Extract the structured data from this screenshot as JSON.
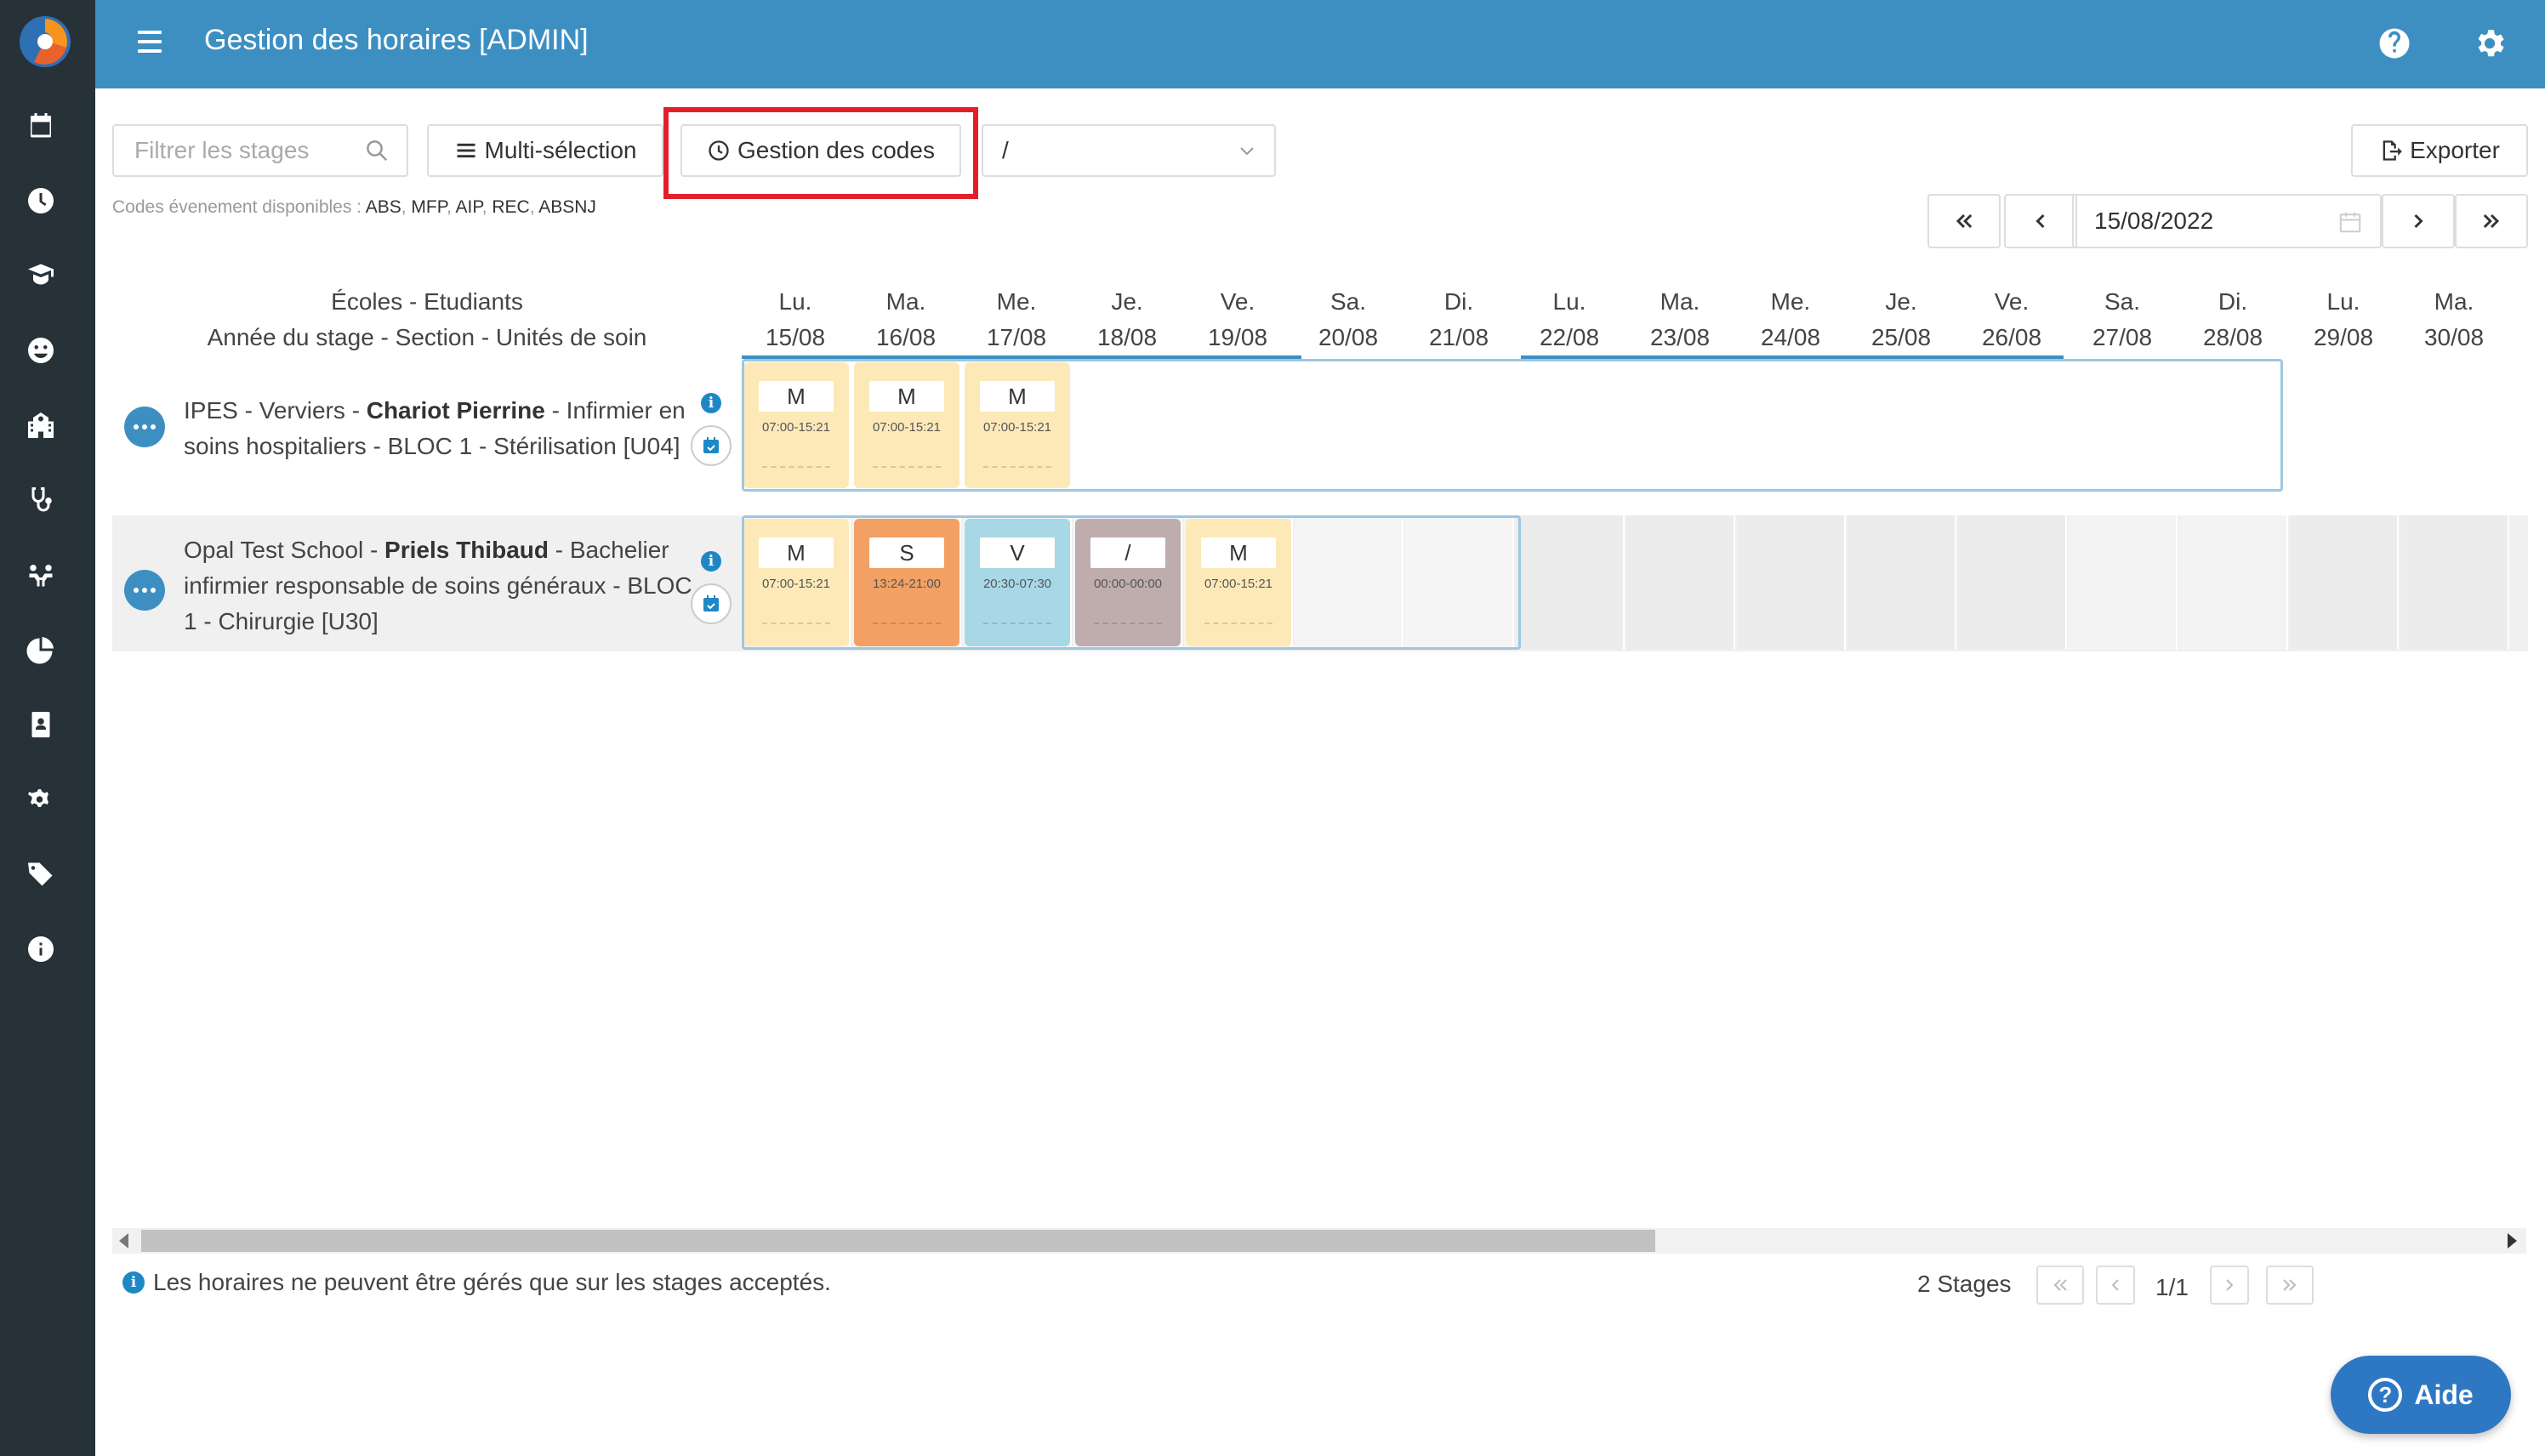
{
  "header": {
    "title": "Gestion des horaires [ADMIN]",
    "icons": [
      "menu-icon",
      "help-icon",
      "gear-icon"
    ]
  },
  "sidebar": {
    "icons": [
      "calendar-icon",
      "clock-icon",
      "graduate-icon",
      "smiley-icon",
      "school-icon",
      "stethoscope-icon",
      "people-icon",
      "pie-chart-icon",
      "badge-icon",
      "gears-icon",
      "tags-icon",
      "info-icon"
    ]
  },
  "toolbar": {
    "filter_placeholder": "Filtrer les stages",
    "multi_selection_label": "Multi-sélection",
    "codes_management_label": "Gestion des codes",
    "select_value": "/",
    "export_label": "Exporter",
    "codes_prefix": "Codes évenement disponibles :",
    "codes": [
      "ABS",
      "MFP",
      "AIP",
      "REC",
      "ABSNJ"
    ]
  },
  "date_nav": {
    "date": "15/08/2022"
  },
  "grid": {
    "header_line1": "Écoles - Etudiants",
    "header_line2": "Année du stage - Section - Unités de soin",
    "days": [
      {
        "day": "Lu.",
        "date": "15/08"
      },
      {
        "day": "Ma.",
        "date": "16/08"
      },
      {
        "day": "Me.",
        "date": "17/08"
      },
      {
        "day": "Je.",
        "date": "18/08"
      },
      {
        "day": "Ve.",
        "date": "19/08"
      },
      {
        "day": "Sa.",
        "date": "20/08"
      },
      {
        "day": "Di.",
        "date": "21/08"
      },
      {
        "day": "Lu.",
        "date": "22/08"
      },
      {
        "day": "Ma.",
        "date": "23/08"
      },
      {
        "day": "Me.",
        "date": "24/08"
      },
      {
        "day": "Je.",
        "date": "25/08"
      },
      {
        "day": "Ve.",
        "date": "26/08"
      },
      {
        "day": "Sa.",
        "date": "27/08"
      },
      {
        "day": "Di.",
        "date": "28/08"
      },
      {
        "day": "Lu.",
        "date": "29/08"
      },
      {
        "day": "Ma.",
        "date": "30/08"
      }
    ],
    "rows": [
      {
        "school": "IPES - Verviers -",
        "student": "Chariot Pierrine",
        "rest1": "- Infirmier en",
        "line2": "soins hospitaliers - BLOC 1 - Stérilisation [U04]",
        "shifts": [
          {
            "code": "M",
            "time": "07:00-15:21",
            "color": "#fde9b8"
          },
          {
            "code": "M",
            "time": "07:00-15:21",
            "color": "#fde9b8"
          },
          {
            "code": "M",
            "time": "07:00-15:21",
            "color": "#fde9b8"
          }
        ]
      },
      {
        "school": "Opal Test School -",
        "student": "Priels Thibaud",
        "rest1": "- Bachelier",
        "line2": "infirmier responsable de soins généraux - BLOC",
        "line3": "1 - Chirurgie [U30]",
        "shifts": [
          {
            "code": "M",
            "time": "07:00-15:21",
            "color": "#fde9b8"
          },
          {
            "code": "S",
            "time": "13:24-21:00",
            "color": "#f2a063"
          },
          {
            "code": "V",
            "time": "20:30-07:30",
            "color": "#a8d8e6"
          },
          {
            "code": "/",
            "time": "00:00-00:00",
            "color": "#bfadad"
          },
          {
            "code": "M",
            "time": "07:00-15:21",
            "color": "#fde9b8"
          }
        ]
      }
    ]
  },
  "footer": {
    "note": "Les horaires ne peuvent être gérés que sur les stages acceptés.",
    "stages_count": "2 Stages",
    "page": "1/1"
  },
  "aide_label": "Aide"
}
